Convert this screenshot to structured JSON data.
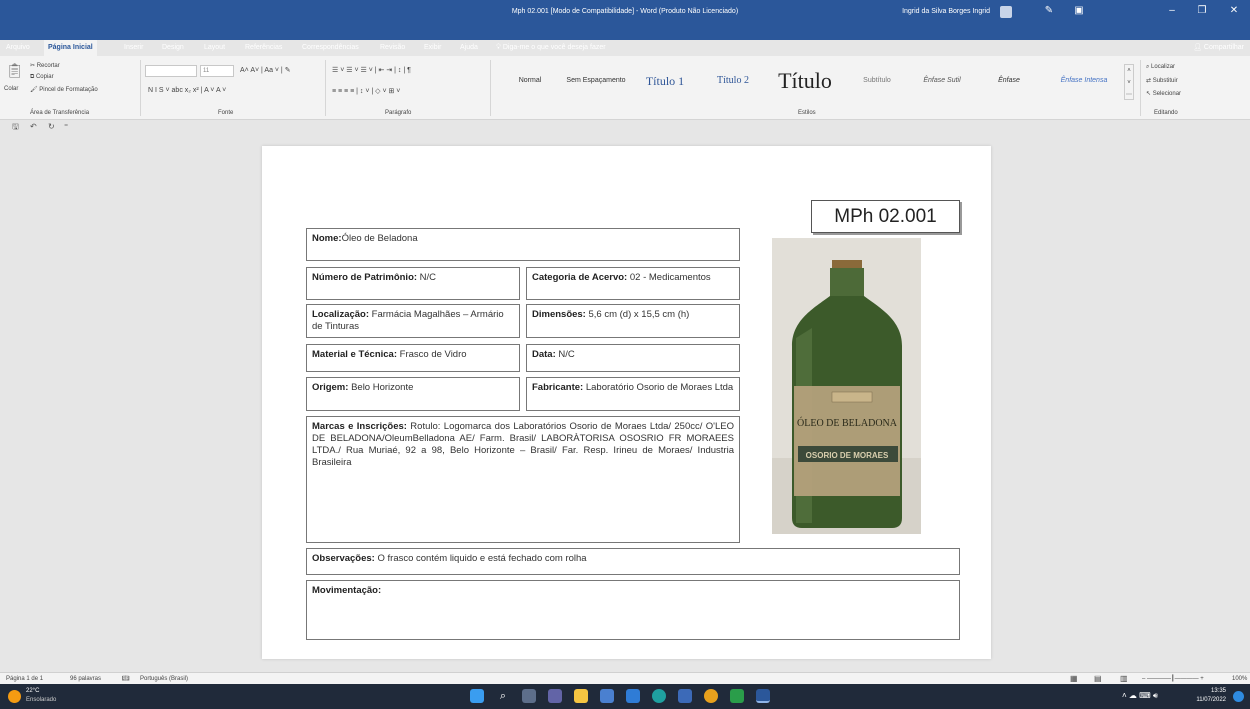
{
  "window": {
    "title": "Mph 02.001 [Modo de Compatibilidade] - Word (Produto Não Licenciado)",
    "user": "Ingrid da Silva Borges Ingrid"
  },
  "tabs": [
    "Arquivo",
    "Página Inicial",
    "Inserir",
    "Design",
    "Layout",
    "Referências",
    "Correspondências",
    "Revisão",
    "Exibir",
    "Ajuda"
  ],
  "tell_me": "Diga-me o que você deseja fazer",
  "share": "Compartilhar",
  "ribbon": {
    "clipboard": {
      "cut": "Recortar",
      "copy": "Copiar",
      "paste": "Colar",
      "format_painter": "Pincel de Formatação",
      "label": "Área de Transferência"
    },
    "font": {
      "name": "",
      "size": "11",
      "label": "Fonte"
    },
    "paragraph": {
      "label": "Parágrafo"
    },
    "styles": {
      "items": [
        "Normal",
        "Sem Espaçamento",
        "Título 1",
        "Título 2",
        "Título",
        "Subtítulo",
        "Ênfase Sutil",
        "Ênfase",
        "Ênfase Intensa"
      ],
      "label": "Estilos"
    },
    "editing": {
      "find": "Localizar",
      "replace": "Substituir",
      "select": "Selecionar",
      "label": "Editando"
    }
  },
  "document": {
    "code": "MPh 02.001",
    "nome": {
      "label": "Nome:",
      "value": "Óleo de Beladona"
    },
    "patrimonio": {
      "label": "Número de Patrimônio:",
      "value": " N/C"
    },
    "categoria": {
      "label": "Categoria de Acervo:",
      "value": " 02 - Medicamentos"
    },
    "localizacao": {
      "label": "Localização:",
      "value": " Farmácia Magalhães – Armário de Tinturas"
    },
    "dimensoes": {
      "label": "Dimensões:",
      "value": " 5,6 cm (d) x 15,5 cm (h)"
    },
    "material": {
      "label": "Material e Técnica:",
      "value": " Frasco de Vidro"
    },
    "data": {
      "label": "Data:",
      "value": " N/C"
    },
    "origem": {
      "label": "Origem:",
      "value": " Belo Horizonte"
    },
    "fabricante": {
      "label": "Fabricante:",
      "value": " Laboratório Osorio de Moraes Ltda"
    },
    "marcas": {
      "label": "Marcas e Inscrições:",
      "value": " Rotulo: Logomarca  dos Laboratórios Osorio de Moraes Ltda/ 250cc/ O'LEO DE BELADONA/OleumBelladona AE/ Farm. Brasil/ LABORÀTORISA OSOSRIO FR MORAEES LTDA./ Rua Muriaé, 92 a 98, Belo Horizonte – Brasil/ Far. Resp. Irineu de Moraes/ Industria Brasileira"
    },
    "observacoes": {
      "label": "Observações:",
      "value": " O frasco contém liquido e está fechado com rolha"
    },
    "movimentacao": {
      "label": "Movimentação:",
      "value": ""
    },
    "bottle_label": {
      "line1": "ÓLEO DE BELADONA",
      "line2": "OSORIO DE MORAES"
    }
  },
  "status": {
    "page": "Página 1 de 1",
    "words": "96 palavras",
    "language": "Português (Brasil)",
    "zoom": "100%"
  },
  "taskbar": {
    "temp": "22°C",
    "weather": "Ensolarado",
    "time": "13:35",
    "date": "11/07/2022"
  },
  "colors": {
    "word_blue": "#2b579a",
    "bottle_green": "#3c5a2a"
  }
}
